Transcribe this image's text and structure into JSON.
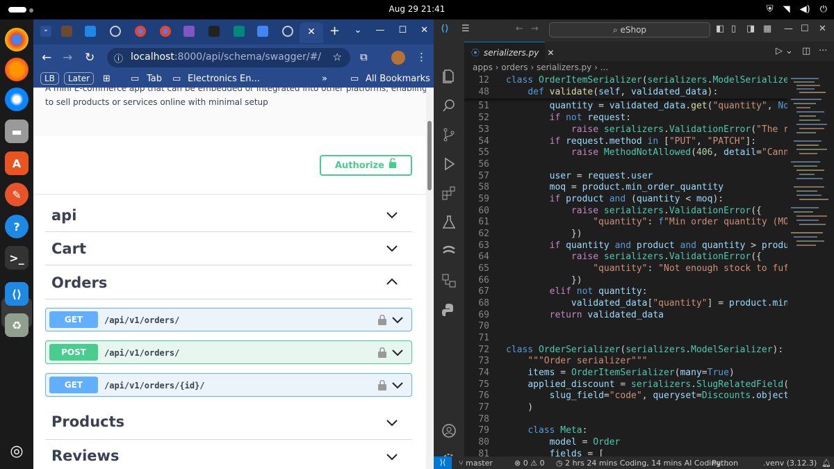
{
  "system": {
    "clock": "Aug 29  21:41"
  },
  "browser": {
    "url_host": "localhost",
    "url_path": ":8000/api/schema/swagger/#/",
    "bookmarks": {
      "lb": "LB",
      "later": "Later",
      "tab": "Tab",
      "electronics": "Electronics En...",
      "more": "»",
      "all": "All Bookmarks"
    }
  },
  "swagger": {
    "description_line1": "A mini E-commerce app that can be embedded or integrated into other platforms, enabling them",
    "description_line2": "to sell products or services online with minimal setup",
    "authorize_label": "Authorize",
    "tags": [
      {
        "name": "api"
      },
      {
        "name": "Cart"
      },
      {
        "name": "Orders"
      },
      {
        "name": "Products"
      },
      {
        "name": "Reviews"
      }
    ],
    "operations": [
      {
        "method": "GET",
        "path": "/api/v1/orders/"
      },
      {
        "method": "POST",
        "path": "/api/v1/orders/"
      },
      {
        "method": "GET",
        "path": "/api/v1/orders/{id}/"
      }
    ],
    "colors": {
      "get": "#61affe",
      "post": "#49cc90"
    }
  },
  "vscode": {
    "search_placeholder": "eShop",
    "tab_name": "serializers.py",
    "breadcrumbs": "apps  ›  orders  ›  serializers.py  ›  ...",
    "line_numbers": [
      "12",
      "48",
      "51",
      "52",
      "53",
      "54",
      "55",
      "56",
      "57",
      "58",
      "59",
      "60",
      "61",
      "62",
      "63",
      "64",
      "65",
      "66",
      "67",
      "68",
      "69",
      "70",
      "71",
      "72",
      "73",
      "74",
      "75",
      "76",
      "77",
      "78",
      "79",
      "80",
      "81"
    ],
    "status": {
      "branch": "master",
      "problems": "⊗ 0 ⚠ 0",
      "coding_time": "2 hrs 24 mins Coding, 14 mins AI Coding...",
      "language": "Python",
      "env": ".venv (3.12.3)"
    }
  }
}
